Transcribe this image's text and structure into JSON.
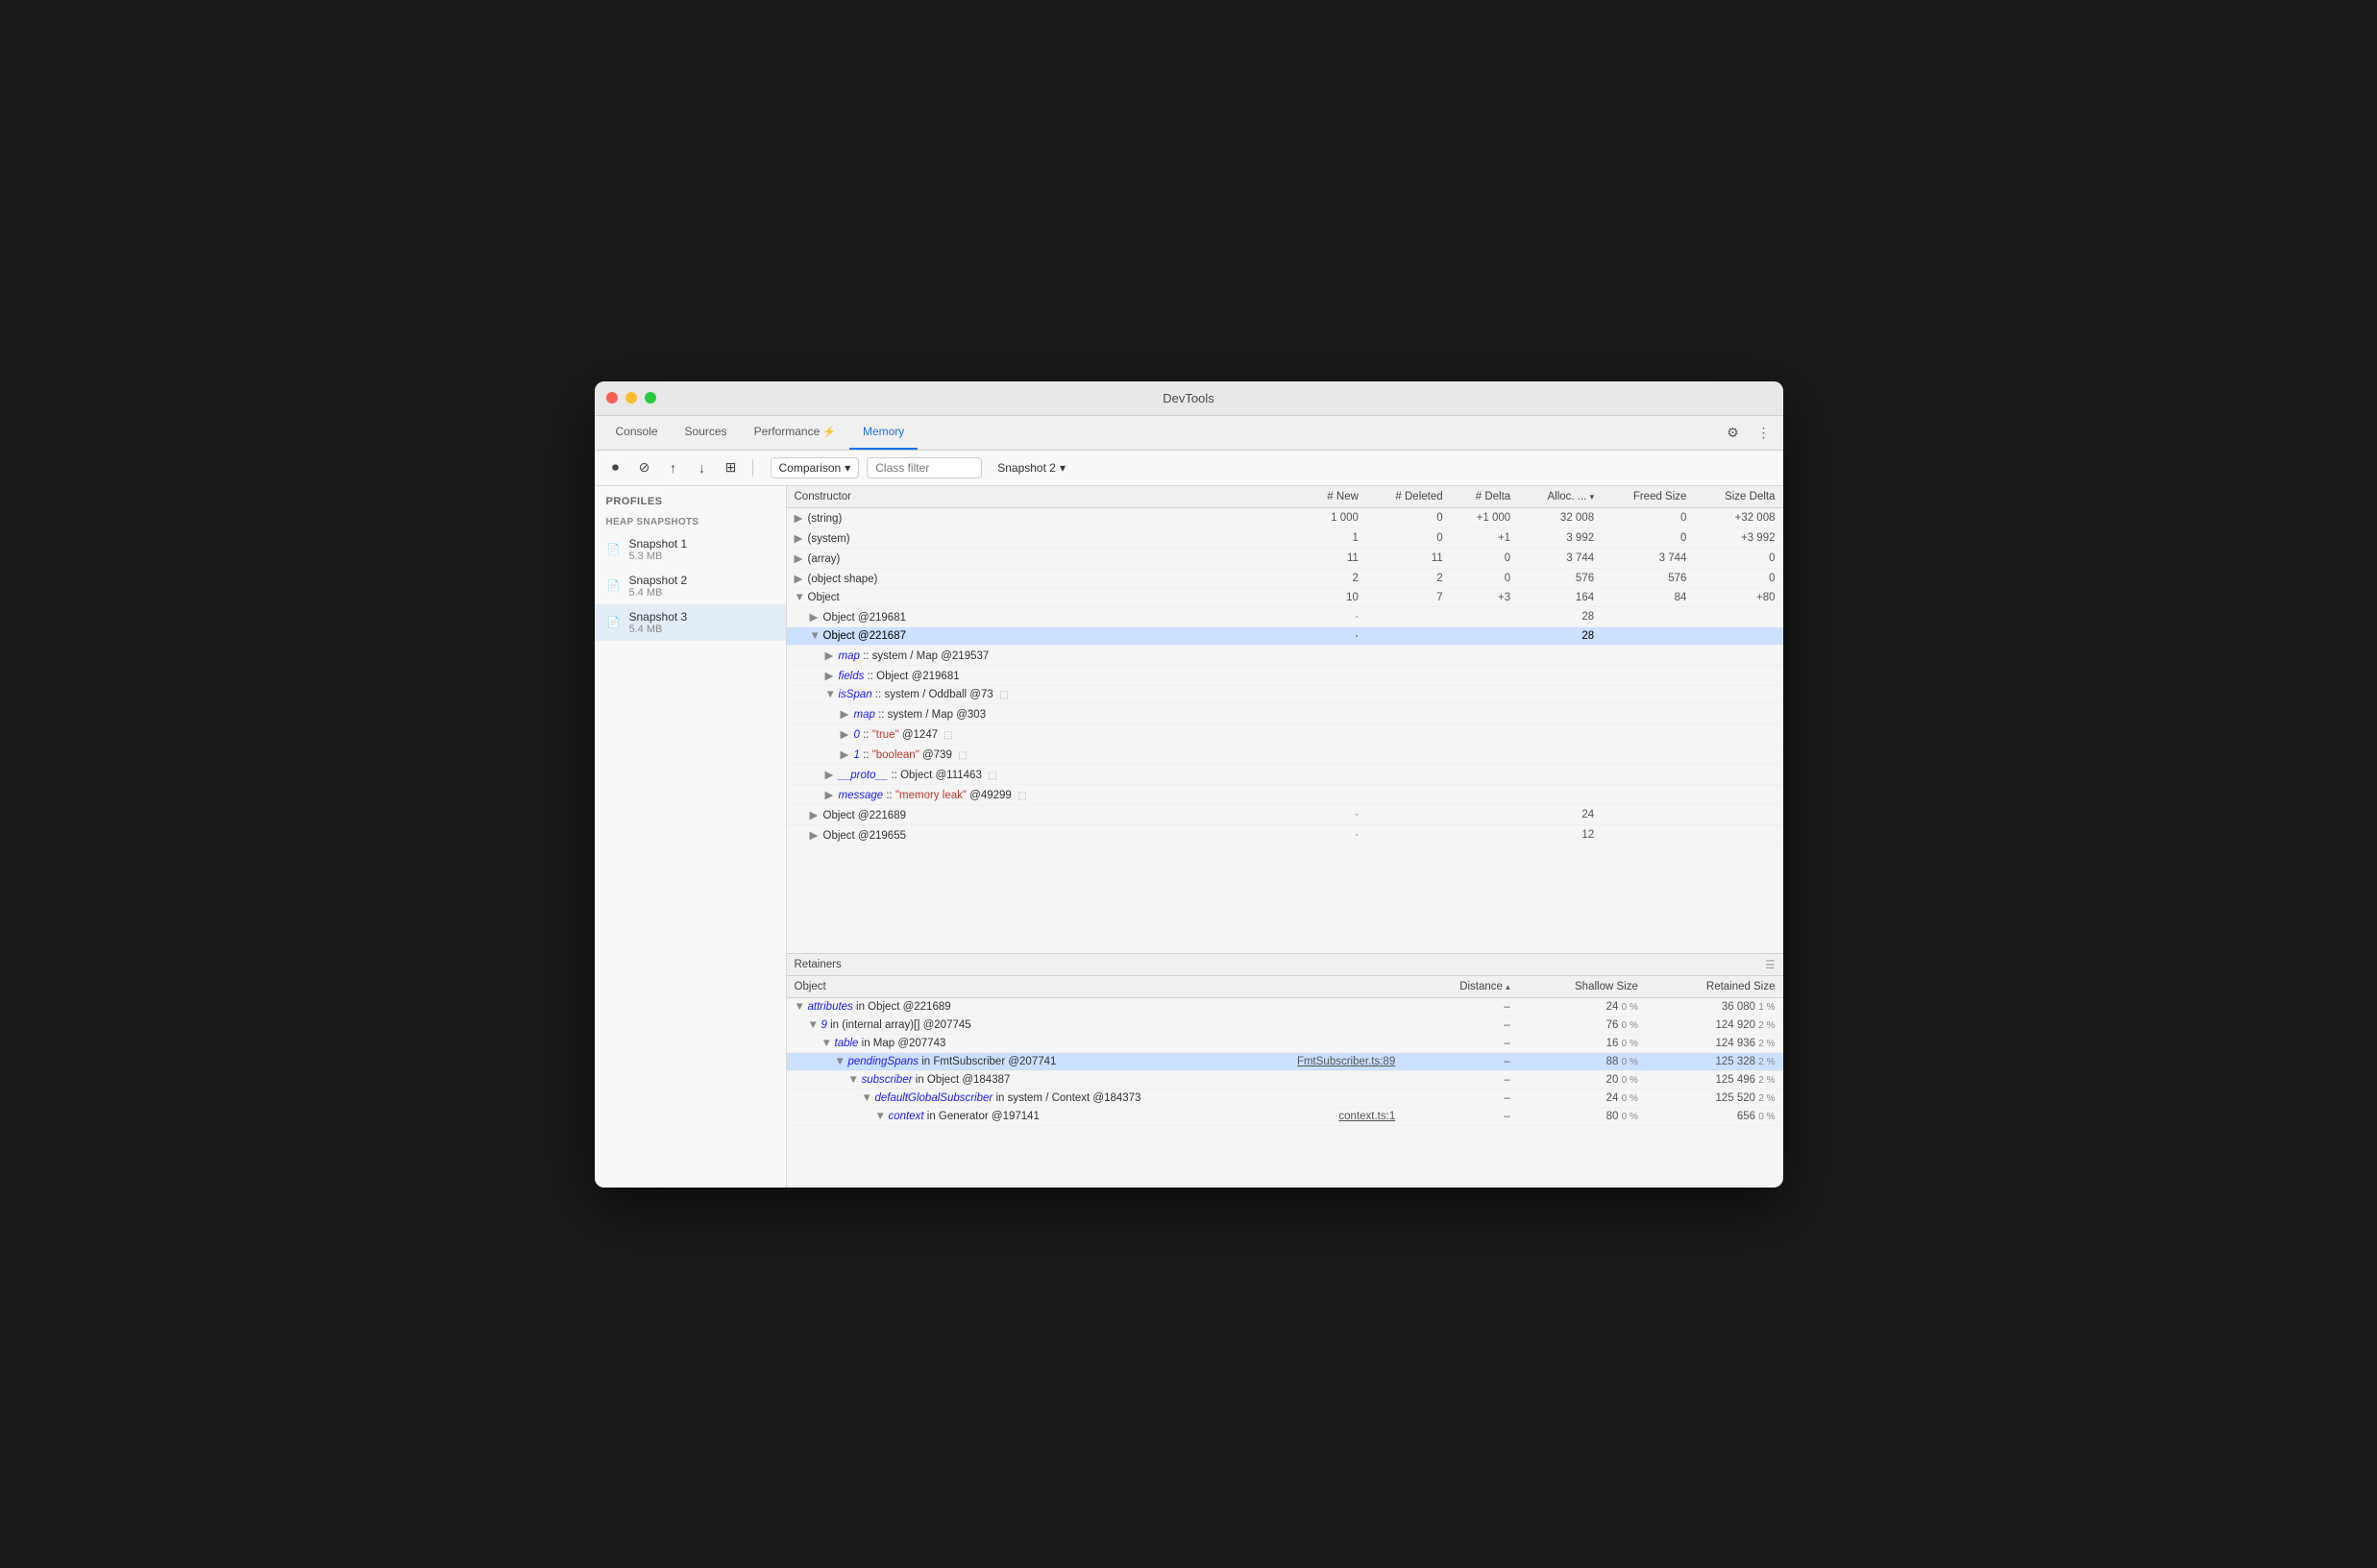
{
  "window": {
    "title": "DevTools"
  },
  "tabs": [
    {
      "label": "Console",
      "active": false
    },
    {
      "label": "Sources",
      "active": false
    },
    {
      "label": "Performance",
      "active": false,
      "has_icon": true
    },
    {
      "label": "Memory",
      "active": true
    }
  ],
  "toolbar": {
    "comparison_label": "Comparison",
    "class_filter_placeholder": "Class filter",
    "snapshot_label": "Snapshot 2"
  },
  "sidebar": {
    "profiles_label": "Profiles",
    "heap_snapshots_label": "HEAP SNAPSHOTS",
    "snapshots": [
      {
        "name": "Snapshot 1",
        "size": "5.3 MB",
        "active": false
      },
      {
        "name": "Snapshot 2",
        "size": "5.4 MB",
        "active": false
      },
      {
        "name": "Snapshot 3",
        "size": "5.4 MB",
        "active": true
      }
    ]
  },
  "upper_table": {
    "headers": [
      "Constructor",
      "# New",
      "# Deleted",
      "# Delta",
      "Alloc. ...",
      "Freed Size",
      "Size Delta"
    ],
    "rows": [
      {
        "constructor": "(string)",
        "new": "1 000",
        "deleted": "0",
        "delta": "+1 000",
        "alloc": "32 008",
        "freed": "0",
        "size_delta": "+32 008",
        "indent": 0,
        "arrow": "▶",
        "selected": false
      },
      {
        "constructor": "(system)",
        "new": "1",
        "deleted": "0",
        "delta": "+1",
        "alloc": "3 992",
        "freed": "0",
        "size_delta": "+3 992",
        "indent": 0,
        "arrow": "▶",
        "selected": false
      },
      {
        "constructor": "(array)",
        "new": "11",
        "deleted": "11",
        "delta": "0",
        "alloc": "3 744",
        "freed": "3 744",
        "size_delta": "0",
        "indent": 0,
        "arrow": "▶",
        "selected": false
      },
      {
        "constructor": "(object shape)",
        "new": "2",
        "deleted": "2",
        "delta": "0",
        "alloc": "576",
        "freed": "576",
        "size_delta": "0",
        "indent": 0,
        "arrow": "▶",
        "selected": false
      },
      {
        "constructor": "Object",
        "new": "10",
        "deleted": "7",
        "delta": "+3",
        "alloc": "164",
        "freed": "84",
        "size_delta": "+80",
        "indent": 0,
        "arrow": "▼",
        "selected": false
      },
      {
        "constructor": "Object @219681",
        "new": "",
        "deleted": "",
        "delta": "",
        "alloc": "28",
        "freed": "",
        "size_delta": "",
        "indent": 1,
        "arrow": "▶",
        "selected": false
      },
      {
        "constructor": "Object @221687",
        "new": "",
        "deleted": "",
        "delta": "",
        "alloc": "28",
        "freed": "",
        "size_delta": "",
        "indent": 1,
        "arrow": "▼",
        "selected": true
      }
    ],
    "expanded_rows": [
      {
        "label": "map :: system / Map @219537",
        "indent": 2,
        "arrow": "▶"
      },
      {
        "label": "fields :: Object @219681",
        "indent": 2,
        "arrow": "▶"
      },
      {
        "label": "isSpan :: system / Oddball @73",
        "indent": 2,
        "arrow": "▼",
        "has_clip": true
      },
      {
        "label": "map :: system / Map @303",
        "indent": 3,
        "arrow": "▶"
      },
      {
        "label": "0 :: \"true\" @1247",
        "indent": 3,
        "arrow": "▶",
        "has_clip": true,
        "val_color": "red"
      },
      {
        "label": "1 :: \"boolean\" @739",
        "indent": 3,
        "arrow": "▶",
        "has_clip": true,
        "val_color": "red"
      },
      {
        "label": "__proto__ :: Object @111463",
        "indent": 2,
        "arrow": "▶",
        "has_clip": true
      },
      {
        "label": "message :: \"memory leak\" @49299",
        "indent": 2,
        "arrow": "▶",
        "has_clip": true,
        "val_color": "red"
      }
    ],
    "more_rows": [
      {
        "constructor": "Object @221689",
        "alloc": "24",
        "indent": 1,
        "arrow": "▶"
      },
      {
        "constructor": "Object @219655",
        "alloc": "12",
        "indent": 1,
        "arrow": "▶"
      }
    ]
  },
  "retainers": {
    "header": "Retainers",
    "headers": [
      "Object",
      "Distance",
      "Shallow Size",
      "Retained Size"
    ],
    "rows": [
      {
        "object": "attributes in Object @221689",
        "distance": "–",
        "shallow": "24",
        "shallow_pct": "0 %",
        "retained": "36 080",
        "retained_pct": "1 %",
        "indent": 0,
        "arrow": "▼"
      },
      {
        "object": "9 in (internal array)[] @207745",
        "distance": "–",
        "shallow": "76",
        "shallow_pct": "0 %",
        "retained": "124 920",
        "retained_pct": "2 %",
        "indent": 1,
        "arrow": "▼"
      },
      {
        "object": "table in Map @207743",
        "distance": "–",
        "shallow": "16",
        "shallow_pct": "0 %",
        "retained": "124 936",
        "retained_pct": "2 %",
        "indent": 2,
        "arrow": "▼"
      },
      {
        "object": "pendingSpans in FmtSubscriber @207741",
        "link": "FmtSubscriber.ts:89",
        "distance": "–",
        "shallow": "88",
        "shallow_pct": "0 %",
        "retained": "125 328",
        "retained_pct": "2 %",
        "indent": 3,
        "arrow": "▼",
        "highlighted": true
      },
      {
        "object": "subscriber in Object @184387",
        "distance": "–",
        "shallow": "20",
        "shallow_pct": "0 %",
        "retained": "125 496",
        "retained_pct": "2 %",
        "indent": 4,
        "arrow": "▼"
      },
      {
        "object": "defaultGlobalSubscriber in system / Context @184373",
        "distance": "–",
        "shallow": "24",
        "shallow_pct": "0 %",
        "retained": "125 520",
        "retained_pct": "2 %",
        "indent": 5,
        "arrow": "▼"
      },
      {
        "object": "context in Generator @197141",
        "link": "context.ts:1",
        "distance": "–",
        "shallow": "80",
        "shallow_pct": "0 %",
        "retained": "656",
        "retained_pct": "0 %",
        "indent": 6,
        "arrow": "▼"
      }
    ]
  }
}
